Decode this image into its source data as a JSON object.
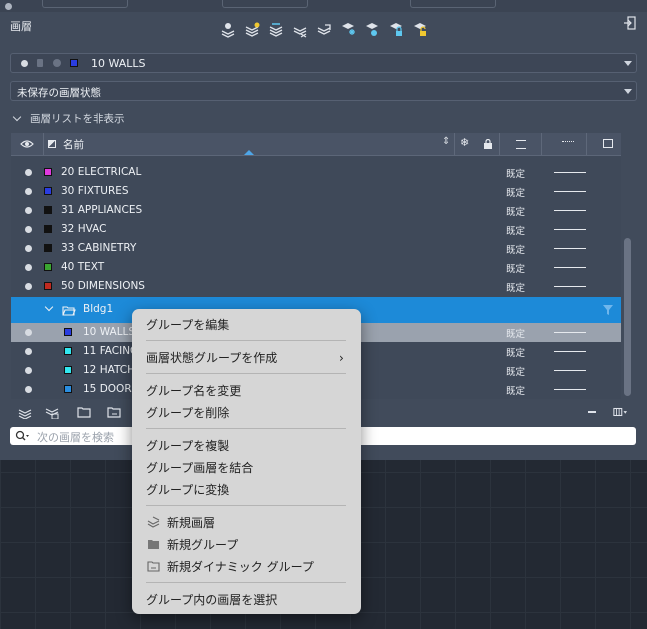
{
  "palette": {
    "title": "画層",
    "current_layer": {
      "name": "10 WALLS",
      "color": "#2a3de0"
    },
    "layer_state": "未保存の画層状態",
    "toggle_label": "画層リストを非表示",
    "columns": {
      "name": "名前"
    },
    "layers_top": [
      {
        "name": "20 ELECTRICAL",
        "color": "#e23ae0",
        "linetype": "既定"
      },
      {
        "name": "30 FIXTURES",
        "color": "#2a3de0",
        "linetype": "既定"
      },
      {
        "name": "31 APPLIANCES",
        "color": "#111111",
        "linetype": "既定"
      },
      {
        "name": "32 HVAC",
        "color": "#111111",
        "linetype": "既定"
      },
      {
        "name": "33 CABINETRY",
        "color": "#111111",
        "linetype": "既定"
      },
      {
        "name": "40 TEXT",
        "color": "#3aa630",
        "linetype": "既定"
      },
      {
        "name": "50 DIMENSIONS",
        "color": "#c02a20",
        "linetype": "既定"
      }
    ],
    "group": {
      "name": "Bldg1"
    },
    "layers_group": [
      {
        "name": "10 WALLS",
        "color": "#2a3de0",
        "linetype": "既定"
      },
      {
        "name": "11 FACING",
        "color": "#32e8f0",
        "linetype": "既定"
      },
      {
        "name": "12 HATCH",
        "color": "#32e8f0",
        "linetype": "既定"
      },
      {
        "name": "15 DOORS",
        "color": "#2a8ee0",
        "linetype": "既定"
      }
    ],
    "search_placeholder": "次の画層を検索"
  },
  "context_menu": {
    "edit_group": "グループを編集",
    "create_state_group": "画層状態グループを作成",
    "rename_group": "グループ名を変更",
    "delete_group": "グループを削除",
    "duplicate_group": "グループを複製",
    "merge_group_layers": "グループ画層を結合",
    "convert_to_group": "グループに変換",
    "new_layer": "新規画層",
    "new_group": "新規グループ",
    "new_dynamic_group": "新規ダイナミック グループ",
    "select_layers_in_group": "グループ内の画層を選択"
  },
  "colors": {
    "accent_selected": "#1d8ad8",
    "row_selected": "#9aa2ae"
  }
}
